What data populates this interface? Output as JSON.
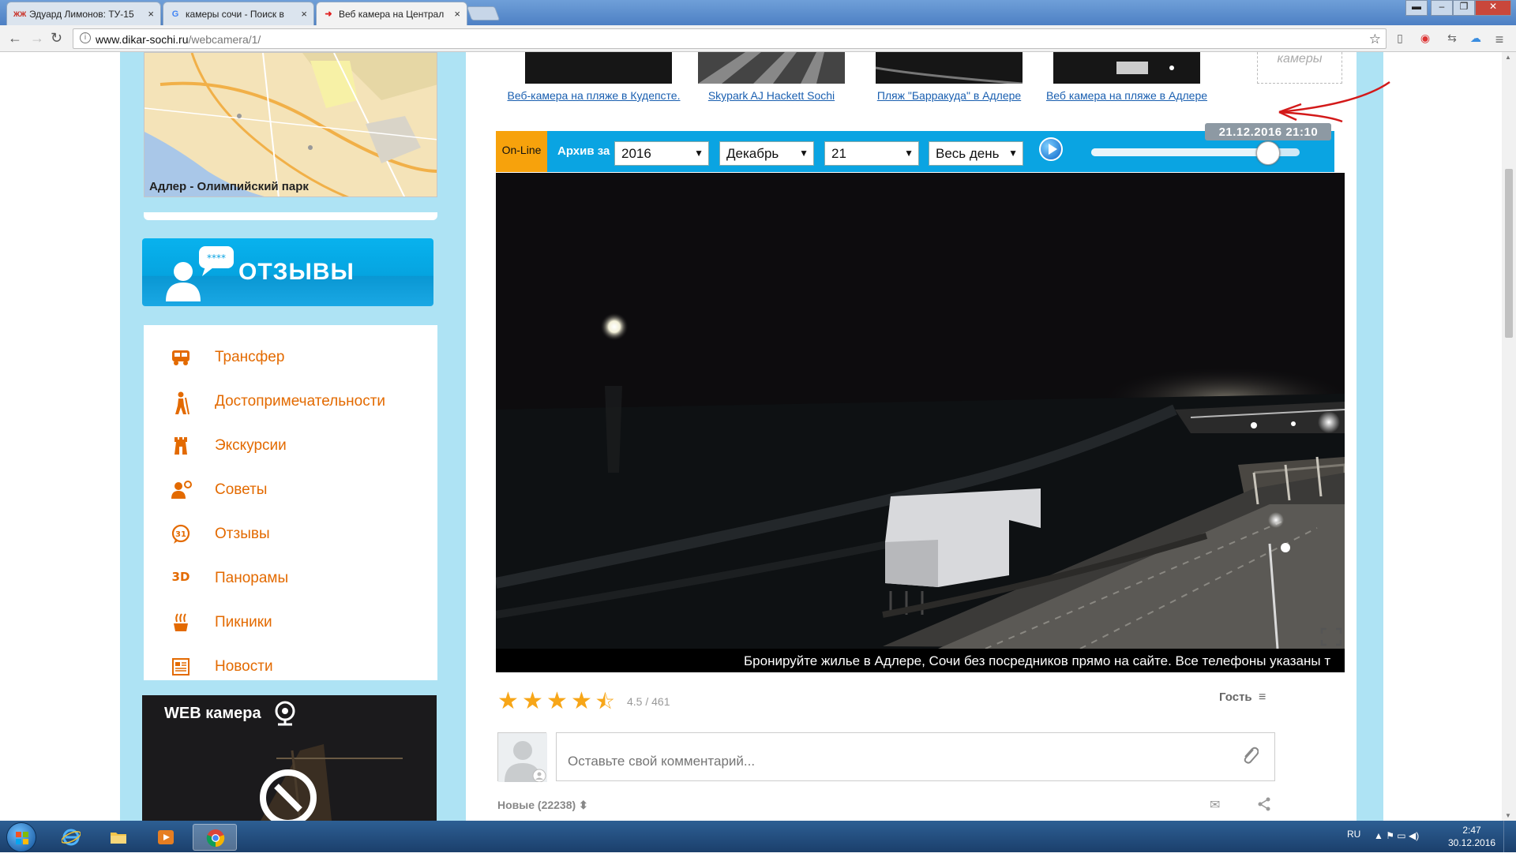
{
  "browser": {
    "tabs": [
      {
        "title": "Эдуард Лимонов: ТУ-15",
        "favicon": "ЖЖ",
        "favicon_color": "#c8281e"
      },
      {
        "title": "камеры сочи - Поиск в",
        "favicon": "G",
        "favicon_color": "#4285f4"
      },
      {
        "title": "Веб камера на Централ",
        "favicon": "➜",
        "favicon_color": "#e02020"
      }
    ],
    "tab_close": "×",
    "url_host": "www.dikar-sochi.ru",
    "url_path": "/webcamera/1/",
    "nav_back": "←",
    "nav_forward": "→",
    "nav_reload": "↻",
    "bookmark_star": "☆",
    "menu_icon": "≡"
  },
  "sidebar": {
    "map_caption": "Адлер - Олимпийский парк",
    "reviews_banner": "ОТЗЫВЫ",
    "menu": [
      {
        "label": "Трансфер",
        "icon": "bus-icon",
        "glyph": "🚌"
      },
      {
        "label": "Достопримечательности",
        "icon": "hiker-icon",
        "glyph": "🚶"
      },
      {
        "label": "Экскурсии",
        "icon": "tower-icon",
        "glyph": "♜"
      },
      {
        "label": "Советы",
        "icon": "advice-icon",
        "glyph": "👤"
      },
      {
        "label": "Отзывы",
        "icon": "review-bubble-icon",
        "glyph": "31"
      },
      {
        "label": "Панорамы",
        "icon": "panorama-3d-icon",
        "glyph": "3D"
      },
      {
        "label": "Пикники",
        "icon": "picnic-icon",
        "glyph": "♨"
      },
      {
        "label": "Новости",
        "icon": "news-icon",
        "glyph": "▤"
      }
    ],
    "webcam_header": "WEB камера"
  },
  "thumbnails": [
    {
      "caption": "Веб-камера на пляже в Кудепсте."
    },
    {
      "caption": "Skypark AJ Hackett Sochi"
    },
    {
      "caption": "Пляж \"Барракуда\" в Адлере"
    },
    {
      "caption": "Веб камера на пляже в Адлере"
    }
  ],
  "more_cameras": "камеры",
  "controls": {
    "online": "On-Line",
    "archive_label": "Архив за",
    "year": "2016",
    "month": "Декабрь",
    "day": "21",
    "period": "Весь день",
    "caret": "▼",
    "timestamp": "21.12.2016 21:10",
    "slider_position": 0.85
  },
  "ticker": "Бронируйте жилье в Адлере, Сочи без посредников прямо на сайте. Все телефоны указаны т",
  "rating": {
    "text": "4.5 / 461",
    "value": 4.5,
    "star_full": "★",
    "star_half": "⯪"
  },
  "user": {
    "guest_label": "Гость",
    "menu_glyph": "≡"
  },
  "comment": {
    "placeholder": "Оставьте свой комментарий..."
  },
  "comments_sort": "Новые (22238)",
  "sort_glyph": "⬍",
  "email_glyph": "✉",
  "share_glyph": "⋖",
  "taskbar": {
    "language": "RU",
    "time": "2:47",
    "date": "30.12.2016",
    "tray_glyphs": "▲ ⚑ ▭ ◀)"
  },
  "colors": {
    "accent_orange": "#e36a00",
    "bar_blue": "#0aa4e2",
    "online_yellow": "#f7a20c",
    "sidebar_blue": "#aee3f4",
    "star": "#f7a618",
    "link": "#1a5fb0"
  }
}
